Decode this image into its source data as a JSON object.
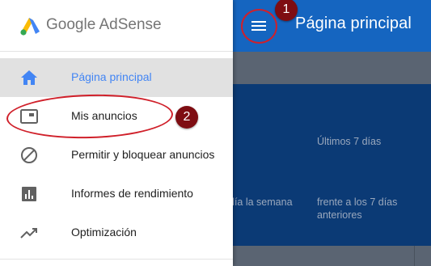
{
  "app": {
    "title": "Página principal"
  },
  "content": {
    "last_7_days": "Últimos 7 días",
    "same_day_week": "día la semana",
    "vs_prev_7_days": "frente a los 7 días anteriores"
  },
  "drawer": {
    "logo_text": "Google AdSense",
    "items": [
      {
        "label": "Página principal",
        "icon": "home-icon",
        "active": true
      },
      {
        "label": "Mis anuncios",
        "icon": "ad-unit-icon",
        "active": false
      },
      {
        "label": "Permitir y bloquear anuncios",
        "icon": "block-icon",
        "active": false
      },
      {
        "label": "Informes de rendimiento",
        "icon": "bar-chart-icon",
        "active": false
      },
      {
        "label": "Optimización",
        "icon": "trending-up-icon",
        "active": false
      }
    ]
  },
  "annotations": {
    "badge_1": "1",
    "badge_2": "2"
  },
  "colors": {
    "header_blue": "#1565c0",
    "active_label": "#4285f4",
    "annotation_red": "#d0202a",
    "badge_dark_red": "#7e0d12"
  }
}
